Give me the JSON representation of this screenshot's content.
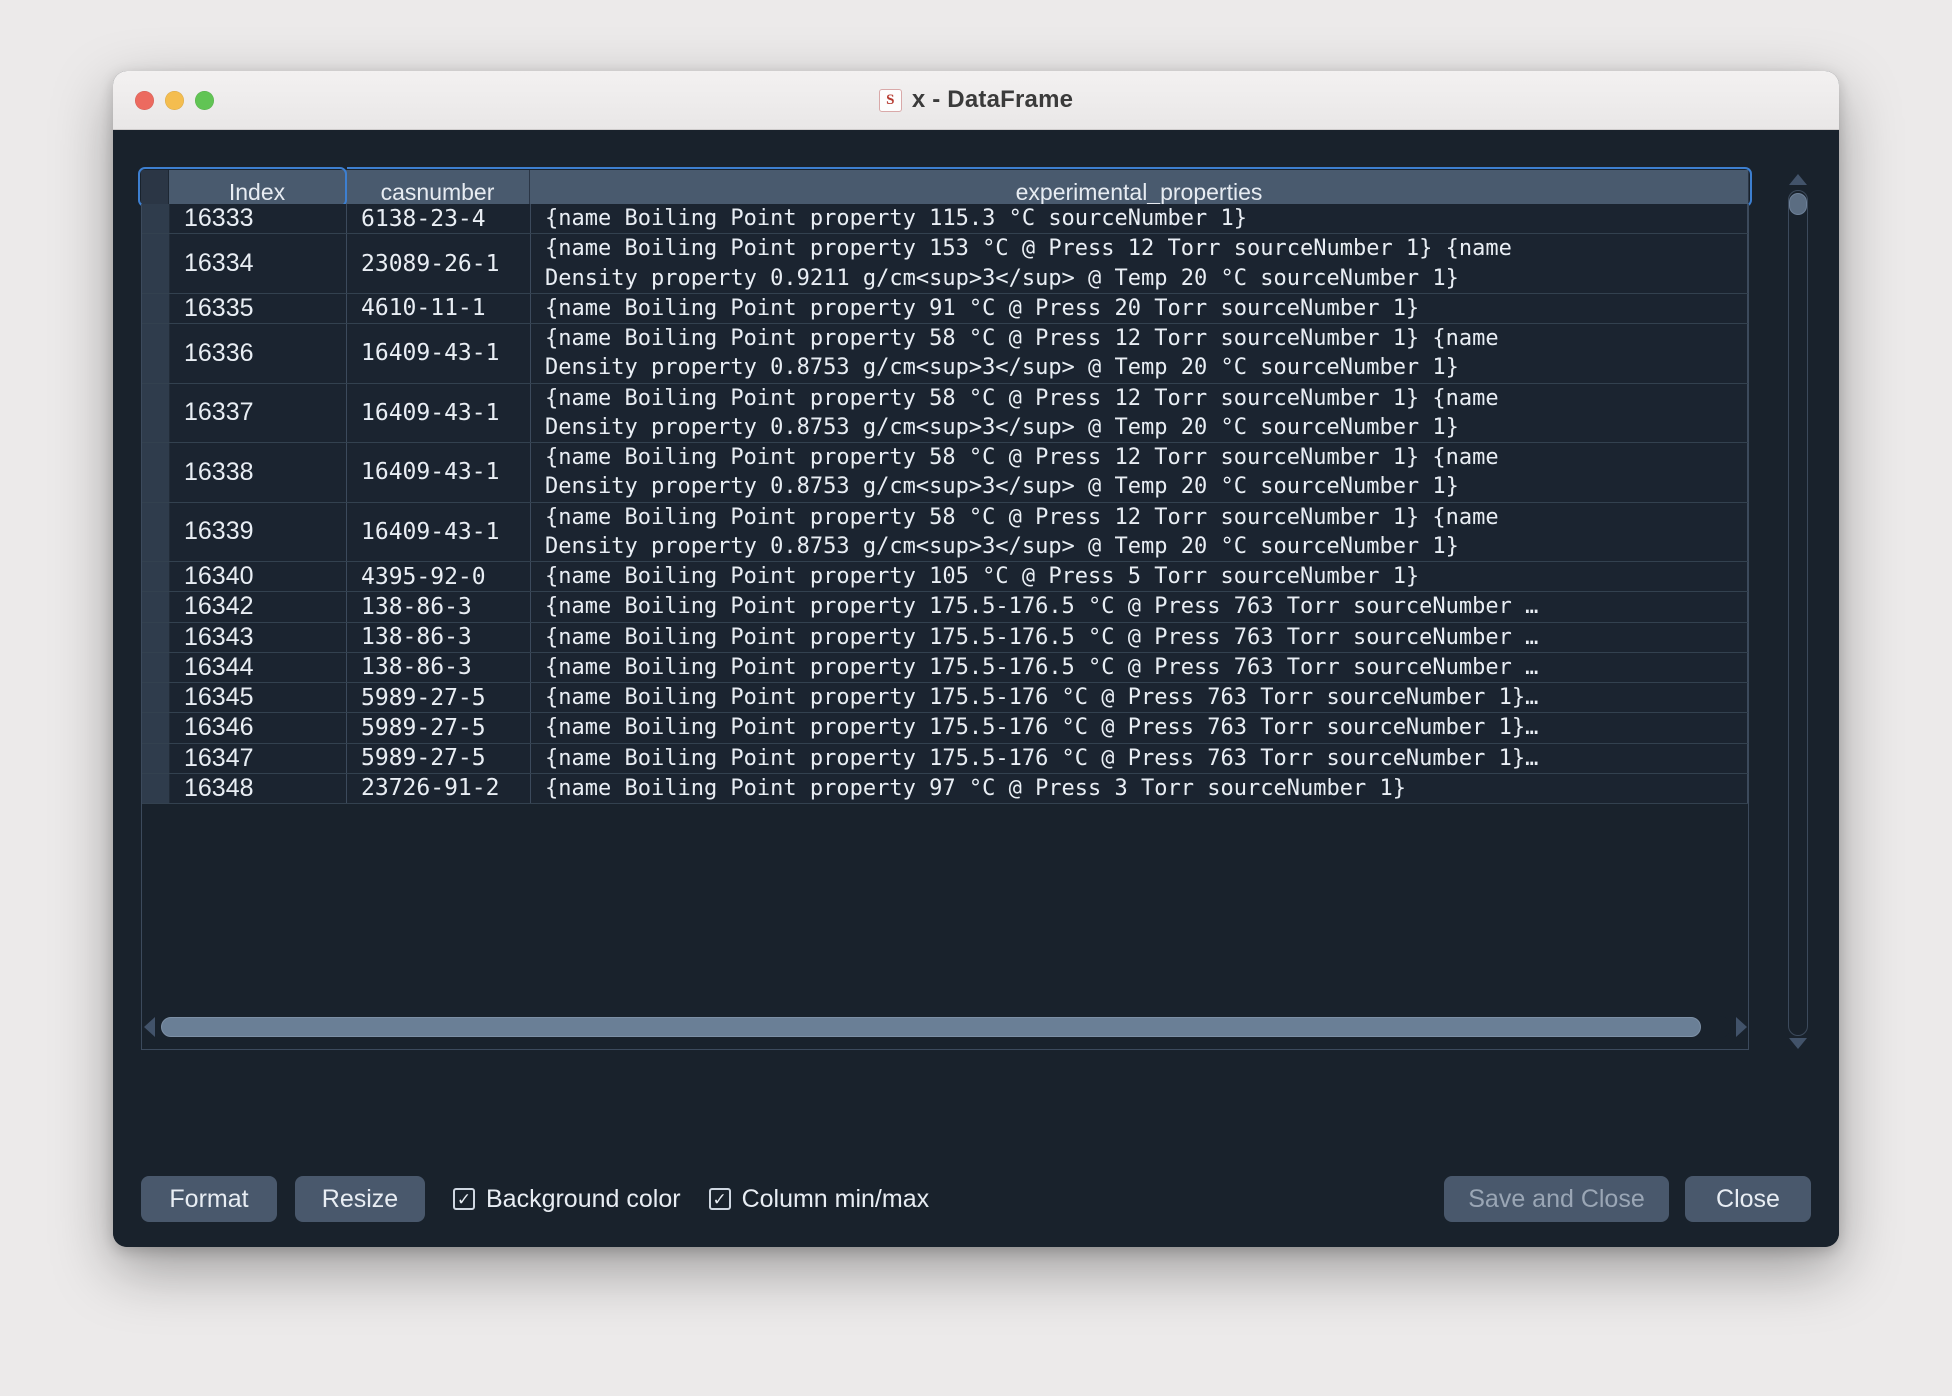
{
  "window": {
    "title": "x - DataFrame",
    "app_icon": "spyder-icon",
    "traffic_lights": [
      "close-light",
      "minimize-light",
      "zoom-light"
    ]
  },
  "table": {
    "columns": [
      "Index",
      "casnumber",
      "experimental_properties"
    ],
    "rows": [
      {
        "index": "16333",
        "casnumber": "6138-23-4",
        "experimental_properties": "{name Boiling Point property 115.3 °C sourceNumber 1}",
        "lines": 1
      },
      {
        "index": "16334",
        "casnumber": "23089-26-1",
        "experimental_properties": "{name Boiling Point property 153 °C @ Press 12 Torr sourceNumber 1} {name\nDensity property 0.9211 g/cm<sup>3</sup> @ Temp 20 °C sourceNumber 1}",
        "lines": 2
      },
      {
        "index": "16335",
        "casnumber": "4610-11-1",
        "experimental_properties": "{name Boiling Point property 91 °C @ Press 20 Torr sourceNumber 1}",
        "lines": 1
      },
      {
        "index": "16336",
        "casnumber": "16409-43-1",
        "experimental_properties": "{name Boiling Point property 58 °C @ Press 12 Torr sourceNumber 1} {name\nDensity property 0.8753 g/cm<sup>3</sup> @ Temp 20 °C sourceNumber 1}",
        "lines": 2
      },
      {
        "index": "16337",
        "casnumber": "16409-43-1",
        "experimental_properties": "{name Boiling Point property 58 °C @ Press 12 Torr sourceNumber 1} {name\nDensity property 0.8753 g/cm<sup>3</sup> @ Temp 20 °C sourceNumber 1}",
        "lines": 2
      },
      {
        "index": "16338",
        "casnumber": "16409-43-1",
        "experimental_properties": "{name Boiling Point property 58 °C @ Press 12 Torr sourceNumber 1} {name\nDensity property 0.8753 g/cm<sup>3</sup> @ Temp 20 °C sourceNumber 1}",
        "lines": 2
      },
      {
        "index": "16339",
        "casnumber": "16409-43-1",
        "experimental_properties": "{name Boiling Point property 58 °C @ Press 12 Torr sourceNumber 1} {name\nDensity property 0.8753 g/cm<sup>3</sup> @ Temp 20 °C sourceNumber 1}",
        "lines": 2
      },
      {
        "index": "16340",
        "casnumber": "4395-92-0",
        "experimental_properties": "{name Boiling Point property 105 °C @ Press 5 Torr sourceNumber 1}",
        "lines": 1
      },
      {
        "index": "16342",
        "casnumber": "138-86-3",
        "experimental_properties": "{name Boiling Point property 175.5-176.5 °C @ Press 763 Torr sourceNumber …",
        "lines": 1
      },
      {
        "index": "16343",
        "casnumber": "138-86-3",
        "experimental_properties": "{name Boiling Point property 175.5-176.5 °C @ Press 763 Torr sourceNumber …",
        "lines": 1
      },
      {
        "index": "16344",
        "casnumber": "138-86-3",
        "experimental_properties": "{name Boiling Point property 175.5-176.5 °C @ Press 763 Torr sourceNumber …",
        "lines": 1
      },
      {
        "index": "16345",
        "casnumber": "5989-27-5",
        "experimental_properties": "{name Boiling Point property 175.5-176 °C @ Press 763 Torr sourceNumber 1}…",
        "lines": 1
      },
      {
        "index": "16346",
        "casnumber": "5989-27-5",
        "experimental_properties": "{name Boiling Point property 175.5-176 °C @ Press 763 Torr sourceNumber 1}…",
        "lines": 1
      },
      {
        "index": "16347",
        "casnumber": "5989-27-5",
        "experimental_properties": "{name Boiling Point property 175.5-176 °C @ Press 763 Torr sourceNumber 1}…",
        "lines": 1
      },
      {
        "index": "16348",
        "casnumber": "23726-91-2",
        "experimental_properties": "{name Boiling Point property 97 °C @ Press 3 Torr sourceNumber 1}",
        "lines": 1
      }
    ]
  },
  "toolbar": {
    "format_label": "Format",
    "resize_label": "Resize",
    "background_color_label": "Background color",
    "background_color_checked": true,
    "column_minmax_label": "Column min/max",
    "column_minmax_checked": true,
    "save_and_close_label": "Save and Close",
    "save_and_close_enabled": false,
    "close_label": "Close"
  },
  "colors": {
    "window_background": "#19222c",
    "header_background": "#495a6e",
    "row_background": "#1b2430",
    "focus_border": "#3d7fd0",
    "button_background": "#49586c",
    "scrollbar_thumb": "#6a7f96"
  }
}
